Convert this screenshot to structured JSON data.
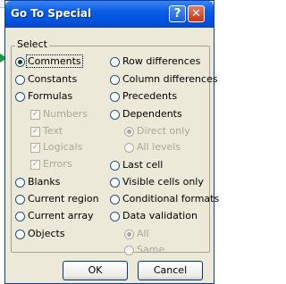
{
  "window": {
    "title": "Go To Special",
    "help_label": "?",
    "close_label": "✕"
  },
  "group": {
    "legend": "Select"
  },
  "left_options": [
    {
      "label": "Comments",
      "selected": true,
      "disabled": false
    },
    {
      "label": "Constants",
      "selected": false,
      "disabled": false
    },
    {
      "label": "Formulas",
      "selected": false,
      "disabled": false
    },
    {
      "label": "Numbers",
      "type": "checkbox",
      "checked": true,
      "disabled": true
    },
    {
      "label": "Text",
      "type": "checkbox",
      "checked": true,
      "disabled": true
    },
    {
      "label": "Logicals",
      "type": "checkbox",
      "checked": true,
      "disabled": true
    },
    {
      "label": "Errors",
      "type": "checkbox",
      "checked": true,
      "disabled": true
    },
    {
      "label": "Blanks",
      "selected": false,
      "disabled": false
    },
    {
      "label": "Current region",
      "selected": false,
      "disabled": false
    },
    {
      "label": "Current array",
      "selected": false,
      "disabled": false
    },
    {
      "label": "Objects",
      "selected": false,
      "disabled": false
    }
  ],
  "right_options": [
    {
      "label": "Row differences",
      "selected": false,
      "disabled": false
    },
    {
      "label": "Column differences",
      "selected": false,
      "disabled": false
    },
    {
      "label": "Precedents",
      "selected": false,
      "disabled": false
    },
    {
      "label": "Dependents",
      "selected": false,
      "disabled": false
    },
    {
      "label": "Direct only",
      "selected": true,
      "disabled": true
    },
    {
      "label": "All levels",
      "selected": false,
      "disabled": true
    },
    {
      "label": "Last cell",
      "selected": false,
      "disabled": false
    },
    {
      "label": "Visible cells only",
      "selected": false,
      "disabled": false
    },
    {
      "label": "Conditional formats",
      "selected": false,
      "disabled": false
    },
    {
      "label": "Data validation",
      "selected": false,
      "disabled": false
    },
    {
      "label": "All",
      "selected": true,
      "disabled": true
    },
    {
      "label": "Same",
      "selected": false,
      "disabled": true
    }
  ],
  "buttons": {
    "ok": "OK",
    "cancel": "Cancel"
  }
}
